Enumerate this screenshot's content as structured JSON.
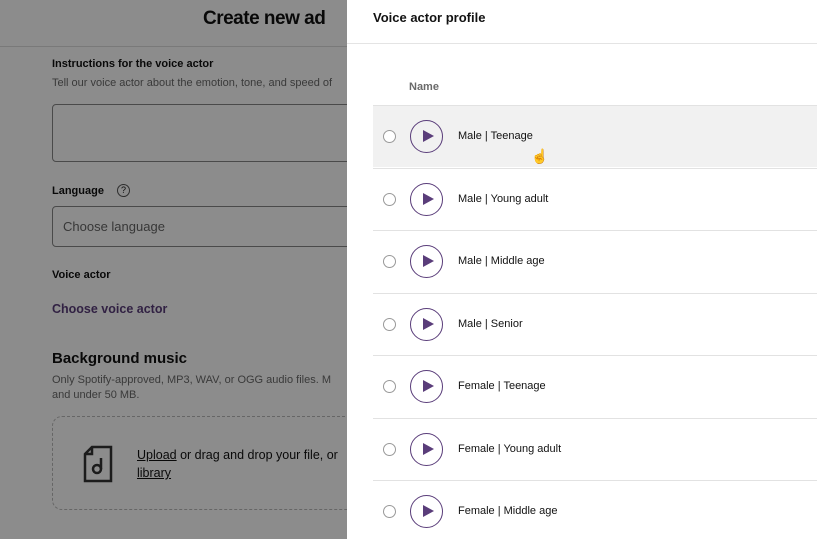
{
  "form": {
    "title": "Create new ad",
    "instructions_label": "Instructions for the voice actor",
    "instructions_help": "Tell our voice actor about the emotion, tone, and speed of",
    "instructions_value": "",
    "language_label": "Language",
    "language_placeholder": "Choose language",
    "voice_actor_label": "Voice actor",
    "choose_voice_actor": "Choose voice actor",
    "background_music_title": "Background music",
    "background_music_help_1": "Only Spotify-approved, MP3, WAV, or OGG audio files. M",
    "background_music_help_2": "and under 50 MB.",
    "upload_link": "Upload",
    "upload_text": " or drag and drop your file, or",
    "library_link": "library"
  },
  "panel": {
    "title": "Voice actor profile",
    "column_name": "Name",
    "rows": [
      {
        "label": "Male | Teenage"
      },
      {
        "label": "Male | Young adult"
      },
      {
        "label": "Male | Middle age"
      },
      {
        "label": "Male | Senior"
      },
      {
        "label": "Female | Teenage"
      },
      {
        "label": "Female | Young adult"
      },
      {
        "label": "Female | Middle age"
      }
    ]
  },
  "colors": {
    "accent": "#5a3d7a"
  }
}
